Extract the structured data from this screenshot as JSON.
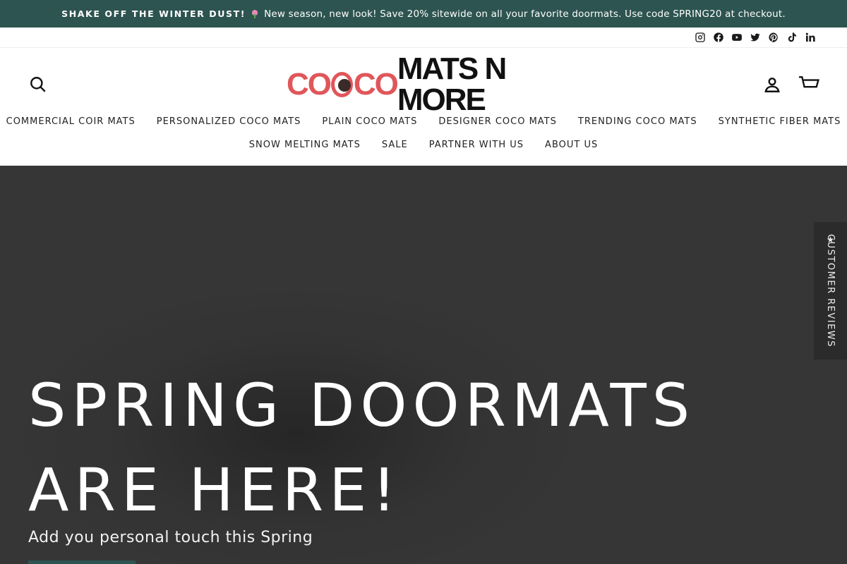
{
  "announcement": {
    "strong": "SHAKE OFF THE WINTER DUST!",
    "text": "New season, new look! Save 20% sitewide on all your favorite doormats. Use code SPRING20 at checkout."
  },
  "social": [
    "instagram-icon",
    "facebook-icon",
    "youtube-icon",
    "twitter-icon",
    "pinterest-icon",
    "tiktok-icon",
    "linkedin-icon"
  ],
  "logo": {
    "part1": "CO",
    "part2": "CO",
    "part3": "MATS N MORE"
  },
  "nav": {
    "row1": [
      "COMMERCIAL COIR MATS",
      "PERSONALIZED COCO MATS",
      "PLAIN COCO MATS",
      "DESIGNER COCO MATS",
      "TRENDING COCO MATS",
      "SYNTHETIC FIBER MATS"
    ],
    "row2": [
      "SNOW MELTING MATS",
      "SALE",
      "PARTNER WITH US",
      "ABOUT US"
    ]
  },
  "hero": {
    "line1": "SPRING DOORMATS",
    "line2": "ARE HERE!",
    "subtitle": "Add you personal touch this Spring"
  },
  "reviews_tab": {
    "label": "CUSTOMER REVIEWS",
    "star": "★"
  },
  "colors": {
    "accent": "#2d5450",
    "brand_red": "#e0565a"
  }
}
